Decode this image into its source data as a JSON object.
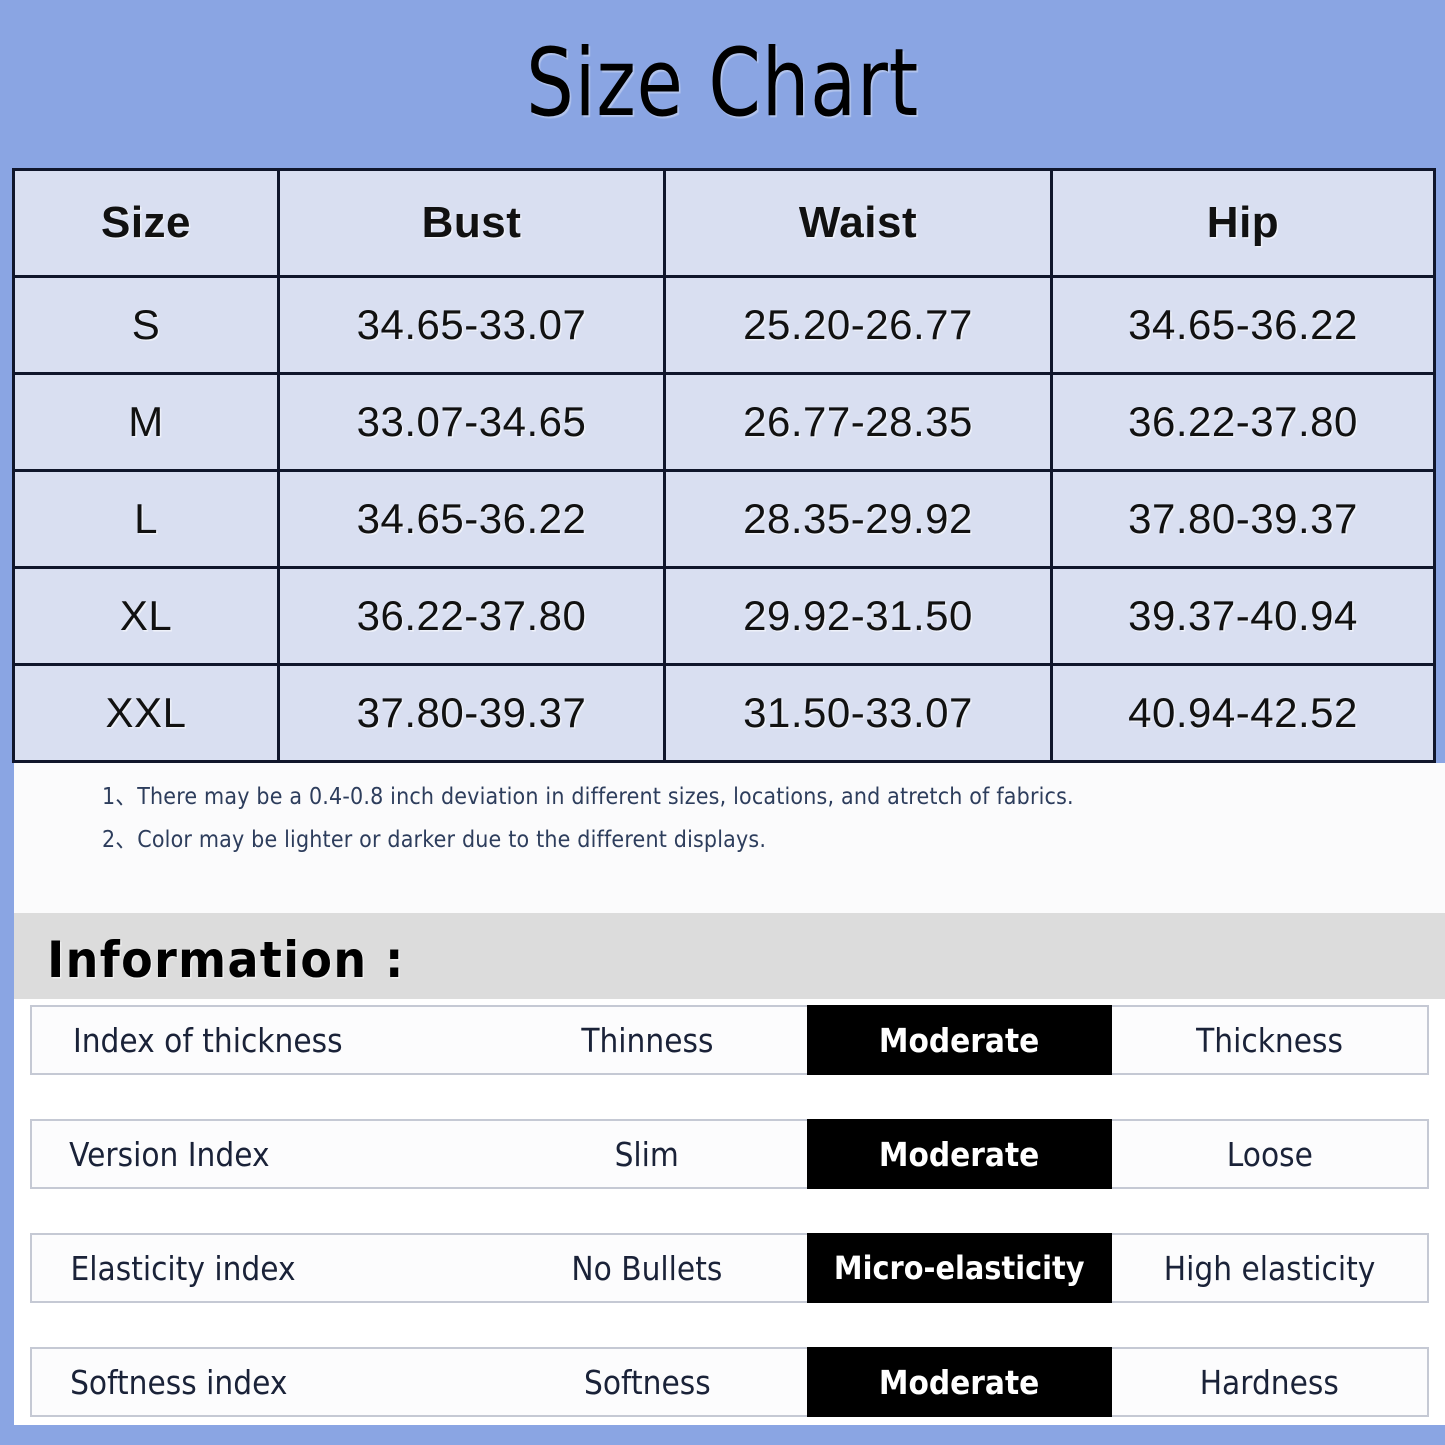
{
  "title": "Size Chart",
  "size_table": {
    "columns": [
      "Size",
      "Bust",
      "Waist",
      "Hip"
    ],
    "rows": [
      {
        "size": "S",
        "bust": "34.65-33.07",
        "waist": "25.20-26.77",
        "hip": "34.65-36.22"
      },
      {
        "size": "M",
        "bust": "33.07-34.65",
        "waist": "26.77-28.35",
        "hip": "36.22-37.80"
      },
      {
        "size": "L",
        "bust": "34.65-36.22",
        "waist": "28.35-29.92",
        "hip": "37.80-39.37"
      },
      {
        "size": "XL",
        "bust": "36.22-37.80",
        "waist": "29.92-31.50",
        "hip": "39.37-40.94"
      },
      {
        "size": "XXL",
        "bust": "37.80-39.37",
        "waist": "31.50-33.07",
        "hip": "40.94-42.52"
      }
    ]
  },
  "notes": [
    {
      "num": "1、",
      "text": "There may be a 0.4-0.8 inch deviation in different sizes, locations, and atretch of fabrics."
    },
    {
      "num": "2、",
      "text": "Color may be lighter or darker due to the different displays."
    }
  ],
  "information": {
    "heading": "Information :",
    "rows": [
      {
        "label": "Index of thickness",
        "left": "Thinness",
        "selected": "Moderate",
        "right": "Thickness"
      },
      {
        "label": "Version Index",
        "left": "Slim",
        "selected": "Moderate",
        "right": "Loose"
      },
      {
        "label": "Elasticity index",
        "left": "No Bullets",
        "selected": "Micro-elasticity",
        "right": "High elasticity"
      },
      {
        "label": "Softness index",
        "left": "Softness",
        "selected": "Moderate",
        "right": "Hardness"
      }
    ]
  },
  "colors": {
    "page_background": "#8aa5e3",
    "table_cell": "#d9dff1",
    "table_border": "#10162b",
    "notes_panel": "#fbfbfc",
    "notes_text": "#2d3d5c",
    "info_band": "#dcdcdc",
    "selected_highlight": "#000000",
    "selected_text": "#ffffff"
  }
}
